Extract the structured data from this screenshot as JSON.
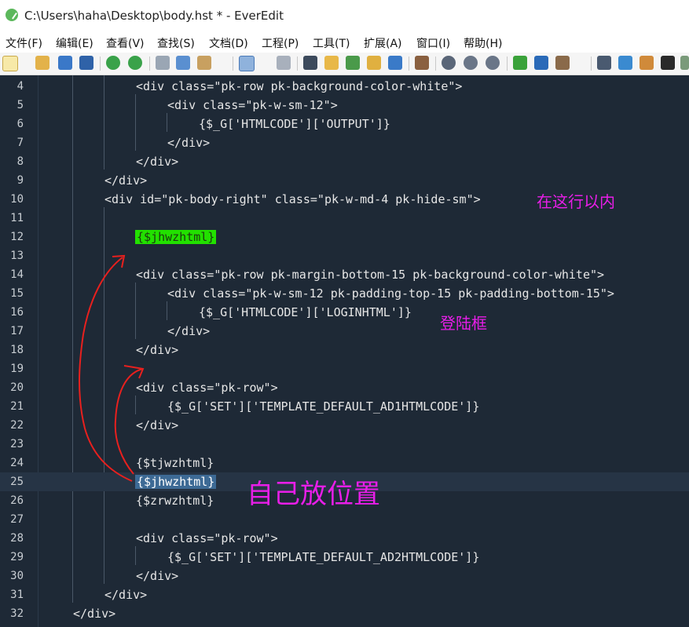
{
  "window": {
    "title": "C:\\Users\\haha\\Desktop\\body.hst * - EverEdit"
  },
  "menu": [
    {
      "label": "文件(F)"
    },
    {
      "label": "编辑(E)"
    },
    {
      "label": "查看(V)"
    },
    {
      "label": "查找(S)"
    },
    {
      "label": "文档(D)"
    },
    {
      "label": "工程(P)"
    },
    {
      "label": "工具(T)"
    },
    {
      "label": "扩展(A)"
    },
    {
      "label": "窗口(I)"
    },
    {
      "label": "帮助(H)"
    }
  ],
  "toolbar": {
    "icons": [
      "new-file-icon",
      "open-icon",
      "save-icon",
      "save-all-icon",
      "undo-icon",
      "redo-icon",
      "cut-icon",
      "copy-icon",
      "paste-icon",
      "wrap-icon",
      "view-icon",
      "find-icon",
      "edit-icon",
      "spell-check-icon",
      "find-in-files-icon",
      "diff-icon",
      "column-icon",
      "bookmark-icon",
      "bookmark-prev-icon",
      "bookmark-next-icon",
      "plugin-icon",
      "panel-icon",
      "tools-icon",
      "window-icon",
      "outline-icon",
      "doc-icon",
      "terminal-icon"
    ]
  },
  "editor": {
    "current_line": 25,
    "lines": [
      {
        "n": "4",
        "text": "<div class=\"pk-row pk-background-color-white\">"
      },
      {
        "n": "5",
        "text": "<div class=\"pk-w-sm-12\">"
      },
      {
        "n": "6",
        "text": "{$_G['HTMLCODE']['OUTPUT']}"
      },
      {
        "n": "7",
        "text": "</div>"
      },
      {
        "n": "8",
        "text": "</div>"
      },
      {
        "n": "9",
        "text": "</div>"
      },
      {
        "n": "10",
        "text": "<div id=\"pk-body-right\" class=\"pk-w-md-4 pk-hide-sm\">"
      },
      {
        "n": "11",
        "text": ""
      },
      {
        "n": "12",
        "text": "{$jhwzhtml}"
      },
      {
        "n": "13",
        "text": ""
      },
      {
        "n": "14",
        "text": "<div class=\"pk-row pk-margin-bottom-15 pk-background-color-white\">"
      },
      {
        "n": "15",
        "text": "<div class=\"pk-w-sm-12 pk-padding-top-15 pk-padding-bottom-15\">"
      },
      {
        "n": "16",
        "text": "{$_G['HTMLCODE']['LOGINHTML']}"
      },
      {
        "n": "17",
        "text": "</div>"
      },
      {
        "n": "18",
        "text": "</div>"
      },
      {
        "n": "19",
        "text": ""
      },
      {
        "n": "20",
        "text": "<div class=\"pk-row\">"
      },
      {
        "n": "21",
        "text": "{$_G['SET']['TEMPLATE_DEFAULT_AD1HTMLCODE']}"
      },
      {
        "n": "22",
        "text": "</div>"
      },
      {
        "n": "23",
        "text": ""
      },
      {
        "n": "24",
        "text": "{$tjwzhtml}"
      },
      {
        "n": "25",
        "text": "{$jhwzhtml}"
      },
      {
        "n": "26",
        "text": "{$zrwzhtml}"
      },
      {
        "n": "27",
        "text": ""
      },
      {
        "n": "28",
        "text": "<div class=\"pk-row\">"
      },
      {
        "n": "29",
        "text": "{$_G['SET']['TEMPLATE_DEFAULT_AD2HTMLCODE']}"
      },
      {
        "n": "30",
        "text": "</div>"
      },
      {
        "n": "31",
        "text": "</div>"
      },
      {
        "n": "32",
        "text": "</div>"
      }
    ]
  },
  "annotations": {
    "inside_line": "在这行以内",
    "login_box": "登陆框",
    "place_self": "自己放位置"
  },
  "colors": {
    "editor_bg": "#1e2936",
    "highlight_green": "#22e000",
    "selection_blue": "#3d6a95",
    "annotation_magenta": "#e81ee8",
    "arrow_red": "#e8201e"
  }
}
